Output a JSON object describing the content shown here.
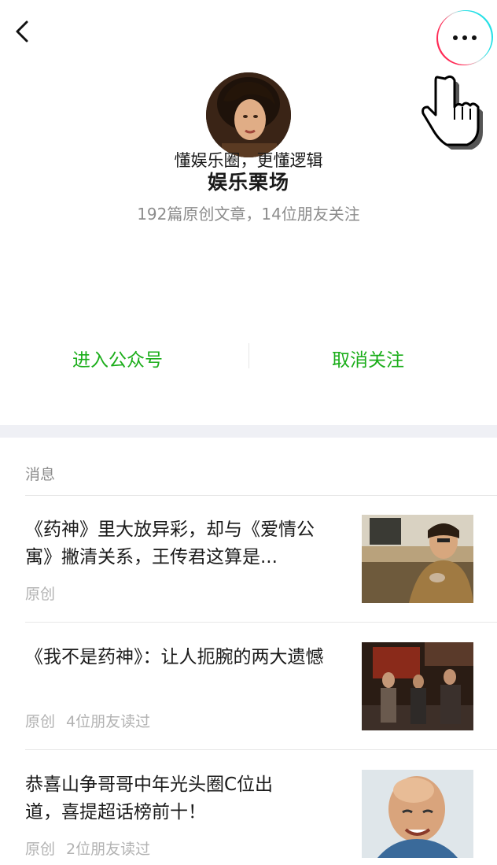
{
  "profile": {
    "name": "娱乐栗场",
    "description": "懂娱乐圈，更懂逻辑",
    "stats": "192篇原创文章，14位朋友关注"
  },
  "actions": {
    "enter": "进入公众号",
    "unfollow": "取消关注"
  },
  "section": {
    "title": "消息"
  },
  "articles": [
    {
      "title": "《药神》里大放异彩，却与《爱情公寓》撇清关系，王传君这算是...",
      "tag": "原创",
      "readers": ""
    },
    {
      "title": "《我不是药神》：让人扼腕的两大遗憾",
      "tag": "原创",
      "readers": "4位朋友读过"
    },
    {
      "title": "恭喜山争哥哥中年光头圈C位出道，喜提超话榜前十！",
      "tag": "原创",
      "readers": "2位朋友读过"
    }
  ],
  "icons": {
    "back": "chevron-left-icon",
    "more": "more-dots-icon",
    "cursor": "hand-pointer-icon"
  },
  "colors": {
    "accent_green": "#1aad19",
    "muted_text": "#8c8c8c",
    "section_band": "#eff0f5"
  }
}
